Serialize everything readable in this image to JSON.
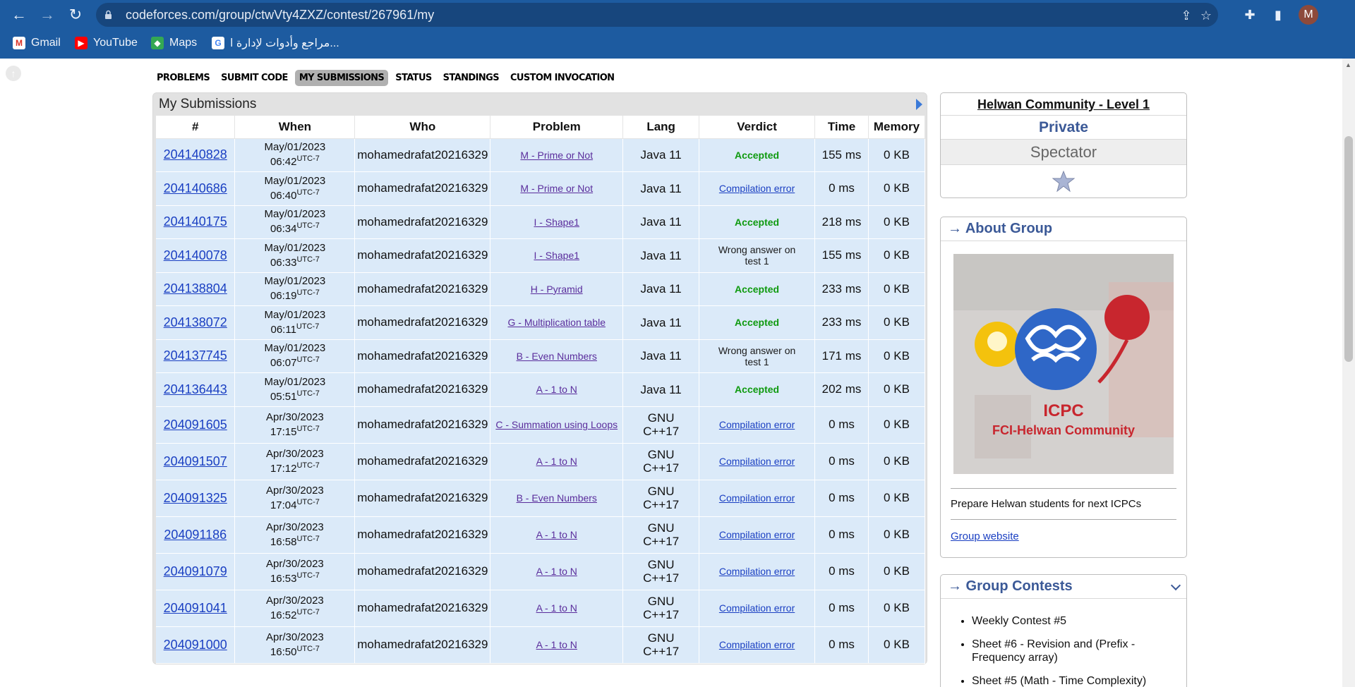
{
  "browser": {
    "url": "codeforces.com/group/ctwVty4ZXZ/contest/267961/my",
    "avatar_letter": "M",
    "bookmarks": [
      {
        "label": "Gmail",
        "icon": "gmail-icon"
      },
      {
        "label": "YouTube",
        "icon": "youtube-icon"
      },
      {
        "label": "Maps",
        "icon": "maps-icon"
      },
      {
        "label": "مراجع وأدوات لإدارة ا...",
        "icon": "google-icon"
      }
    ]
  },
  "tabs": [
    "PROBLEMS",
    "SUBMIT CODE",
    "MY SUBMISSIONS",
    "STATUS",
    "STANDINGS",
    "CUSTOM INVOCATION"
  ],
  "submissions": {
    "title": "My Submissions",
    "headers": [
      "#",
      "When",
      "Who",
      "Problem",
      "Lang",
      "Verdict",
      "Time",
      "Memory"
    ],
    "rows": [
      {
        "id": "204140828",
        "date": "May/01/2023",
        "time": "06:42",
        "tz": "UTC-7",
        "who": "mohamedrafat20216329",
        "problem": "M - Prime or Not",
        "lang1": "Java 11",
        "lang2": "",
        "verdict": "Accepted",
        "vclass": "acc",
        "t": "155 ms",
        "mem": "0 KB"
      },
      {
        "id": "204140686",
        "date": "May/01/2023",
        "time": "06:40",
        "tz": "UTC-7",
        "who": "mohamedrafat20216329",
        "problem": "M - Prime or Not",
        "lang1": "Java 11",
        "lang2": "",
        "verdict": "Compilation error",
        "vclass": "ce",
        "t": "0 ms",
        "mem": "0 KB"
      },
      {
        "id": "204140175",
        "date": "May/01/2023",
        "time": "06:34",
        "tz": "UTC-7",
        "who": "mohamedrafat20216329",
        "problem": "I - Shape1",
        "lang1": "Java 11",
        "lang2": "",
        "verdict": "Accepted",
        "vclass": "acc",
        "t": "218 ms",
        "mem": "0 KB"
      },
      {
        "id": "204140078",
        "date": "May/01/2023",
        "time": "06:33",
        "tz": "UTC-7",
        "who": "mohamedrafat20216329",
        "problem": "I - Shape1",
        "lang1": "Java 11",
        "lang2": "",
        "verdict": "Wrong answer on test 1",
        "vclass": "wa",
        "t": "155 ms",
        "mem": "0 KB"
      },
      {
        "id": "204138804",
        "date": "May/01/2023",
        "time": "06:19",
        "tz": "UTC-7",
        "who": "mohamedrafat20216329",
        "problem": "H - Pyramid",
        "lang1": "Java 11",
        "lang2": "",
        "verdict": "Accepted",
        "vclass": "acc",
        "t": "233 ms",
        "mem": "0 KB"
      },
      {
        "id": "204138072",
        "date": "May/01/2023",
        "time": "06:11",
        "tz": "UTC-7",
        "who": "mohamedrafat20216329",
        "problem": "G - Multiplication table",
        "lang1": "Java 11",
        "lang2": "",
        "verdict": "Accepted",
        "vclass": "acc",
        "t": "233 ms",
        "mem": "0 KB"
      },
      {
        "id": "204137745",
        "date": "May/01/2023",
        "time": "06:07",
        "tz": "UTC-7",
        "who": "mohamedrafat20216329",
        "problem": "B - Even Numbers",
        "lang1": "Java 11",
        "lang2": "",
        "verdict": "Wrong answer on test 1",
        "vclass": "wa",
        "t": "171 ms",
        "mem": "0 KB"
      },
      {
        "id": "204136443",
        "date": "May/01/2023",
        "time": "05:51",
        "tz": "UTC-7",
        "who": "mohamedrafat20216329",
        "problem": "A - 1 to N",
        "lang1": "Java 11",
        "lang2": "",
        "verdict": "Accepted",
        "vclass": "acc",
        "t": "202 ms",
        "mem": "0 KB"
      },
      {
        "id": "204091605",
        "date": "Apr/30/2023",
        "time": "17:15",
        "tz": "UTC-7",
        "who": "mohamedrafat20216329",
        "problem": "C - Summation using Loops",
        "lang1": "GNU",
        "lang2": "C++17",
        "verdict": "Compilation error",
        "vclass": "ce",
        "t": "0 ms",
        "mem": "0 KB"
      },
      {
        "id": "204091507",
        "date": "Apr/30/2023",
        "time": "17:12",
        "tz": "UTC-7",
        "who": "mohamedrafat20216329",
        "problem": "A - 1 to N",
        "lang1": "GNU",
        "lang2": "C++17",
        "verdict": "Compilation error",
        "vclass": "ce",
        "t": "0 ms",
        "mem": "0 KB"
      },
      {
        "id": "204091325",
        "date": "Apr/30/2023",
        "time": "17:04",
        "tz": "UTC-7",
        "who": "mohamedrafat20216329",
        "problem": "B - Even Numbers",
        "lang1": "GNU",
        "lang2": "C++17",
        "verdict": "Compilation error",
        "vclass": "ce",
        "t": "0 ms",
        "mem": "0 KB"
      },
      {
        "id": "204091186",
        "date": "Apr/30/2023",
        "time": "16:58",
        "tz": "UTC-7",
        "who": "mohamedrafat20216329",
        "problem": "A - 1 to N",
        "lang1": "GNU",
        "lang2": "C++17",
        "verdict": "Compilation error",
        "vclass": "ce",
        "t": "0 ms",
        "mem": "0 KB"
      },
      {
        "id": "204091079",
        "date": "Apr/30/2023",
        "time": "16:53",
        "tz": "UTC-7",
        "who": "mohamedrafat20216329",
        "problem": "A - 1 to N",
        "lang1": "GNU",
        "lang2": "C++17",
        "verdict": "Compilation error",
        "vclass": "ce",
        "t": "0 ms",
        "mem": "0 KB"
      },
      {
        "id": "204091041",
        "date": "Apr/30/2023",
        "time": "16:52",
        "tz": "UTC-7",
        "who": "mohamedrafat20216329",
        "problem": "A - 1 to N",
        "lang1": "GNU",
        "lang2": "C++17",
        "verdict": "Compilation error",
        "vclass": "ce",
        "t": "0 ms",
        "mem": "0 KB"
      },
      {
        "id": "204091000",
        "date": "Apr/30/2023",
        "time": "16:50",
        "tz": "UTC-7",
        "who": "mohamedrafat20216329",
        "problem": "A - 1 to N",
        "lang1": "GNU",
        "lang2": "C++17",
        "verdict": "Compilation error",
        "vclass": "ce",
        "t": "0 ms",
        "mem": "0 KB"
      }
    ]
  },
  "sidebar": {
    "group_name": "Helwan Community - Level 1",
    "privacy": "Private",
    "role": "Spectator",
    "about_title": "→ About Group",
    "image_text_1": "ICPC",
    "image_text_2": "FCI-Helwan Community",
    "description": "Prepare Helwan students for next ICPCs",
    "website_link": "Group website",
    "contests_title": "→ Group Contests",
    "contests": [
      "Weekly Contest #5",
      "Sheet #6 - Revision and (Prefix - Frequency array)",
      "Sheet #5 (Math - Time Complexity)"
    ]
  },
  "colors": {
    "chrome": "#1d5ba0",
    "accepted": "#0f9a0f",
    "link": "#1a3fc2",
    "row_bg": "#dbeaf9",
    "sidebar_title": "#3b5997"
  }
}
